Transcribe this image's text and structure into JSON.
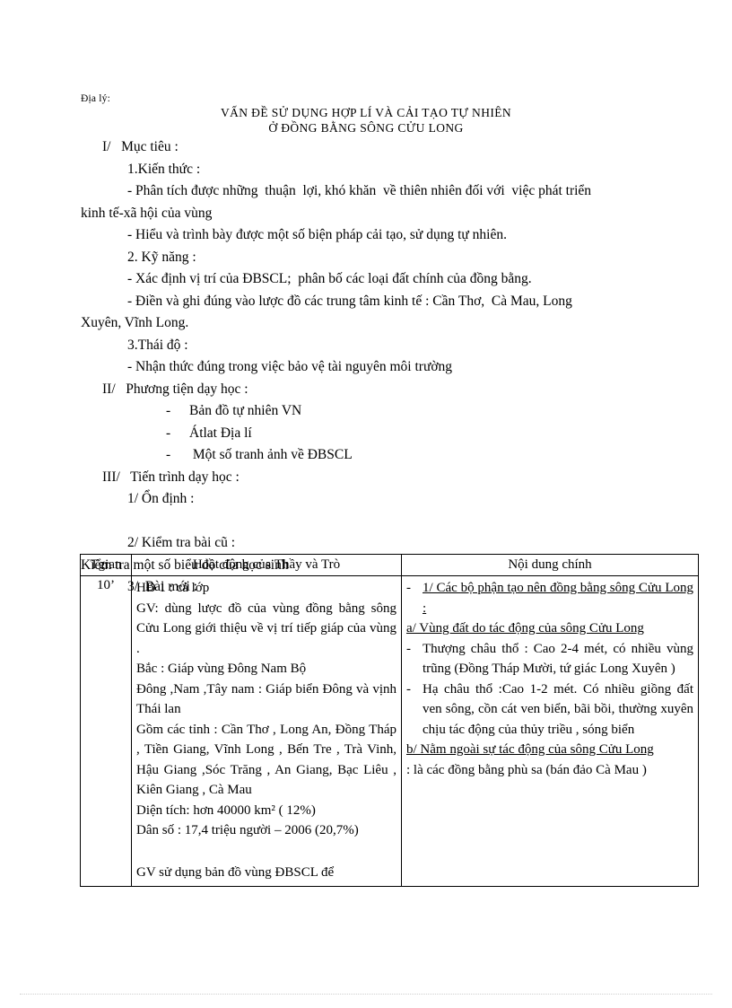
{
  "document": {
    "subject_label": "Địa lý:",
    "title_line_1": "VẤN ĐỀ SỬ DỤNG HỢP LÍ VÀ CẢI TẠO TỰ NHIÊN",
    "title_line_2": "Ở ĐỒNG BẰNG SÔNG CỬU LONG"
  },
  "sections": {
    "s1_heading": "I/   Mục tiêu :",
    "s1_1_heading": "1.Kiến thức :",
    "s1_1_item_1": "- Phân tích được những  thuận  lợi, khó khăn  về thiên nhiên đối với  việc phát triển",
    "s1_1_item_1_cont": "kinh tế-xã hội của vùng",
    "s1_1_item_2": "- Hiểu và trình bày được một số biện pháp cải tạo, sử dụng tự nhiên.",
    "s1_2_heading": "2. Kỹ năng :",
    "s1_2_item_1": "- Xác định vị trí của ĐBSCL;  phân bố các loại đất chính của đồng bằng.",
    "s1_2_item_2": "- Điền và ghi đúng vào lược đồ các trung tâm kinh tế : Cần Thơ,  Cà Mau, Long",
    "s1_2_item_2_cont": "Xuyên, Vĩnh Long.",
    "s1_3_heading": "3.Thái độ :",
    "s1_3_item_1": "- Nhận thức đúng trong việc bảo vệ tài nguyên môi trường",
    "s2_heading": "II/   Phương tiện dạy học :",
    "s2_items": [
      "Bản đồ tự nhiên VN",
      "Átlat Địa lí",
      " Một số tranh ảnh về ĐBSCL"
    ],
    "s3_heading": "III/   Tiến trình dạy học :",
    "s3_1": "1/ Ổn định :",
    "s3_2": "2/ Kiểm tra bài cũ :",
    "s3_2_detail": "Kiểm tra một số biểu đồ của học sinh",
    "s3_3": "3/  Bài mới :"
  },
  "table": {
    "headers": {
      "time": "Tgian",
      "activity": "Hoạt động của Thầy và Trò",
      "content": "Nội dung chính"
    },
    "row": {
      "time": "10’",
      "activity_lines": [
        "HĐ 1 : cả lớp",
        " GV:    dùng  lược  đồ  của  vùng  đồng bằng sông Cửu Long  giới thiệu về vị trí tiếp giáp của vùng .",
        "Bắc            : Giáp vùng Đông Nam Bộ",
        "Đông ,Nam ,Tây nam      : Giáp biển Đông và vịnh Thái lan",
        "Gồm các tỉnh : Cần Thơ , Long An, Đồng Tháp , Tiền Giang, Vĩnh Long , Bến Tre , Trà Vinh, Hậu Giang ,Sóc Trăng , An Giang, Bạc Liêu , Kiên Giang , Cà Mau",
        "Diện tích: hơn 40000 km² ( 12%)",
        "Dân số :  17,4  triệu người  –  2006 (20,7%)",
        "",
        "GV sử dụng bản đồ vùng ĐBSCL để"
      ],
      "content_bullets": [
        {
          "mark": "-",
          "heading": "1/ Các bộ phận tạo nên đồng bằng sông Cửu Long :",
          "subheading": "a/ Vùng đất do tác động của sông Cửu Long"
        },
        {
          "mark": "-",
          "text": "Thượng châu thổ : Cao 2-4 mét, có nhiều vùng trũng (Đồng Tháp Mười, tứ giác Long Xuyên )"
        },
        {
          "mark": "-",
          "text": "Hạ châu thổ :Cao 1-2 mét. Có nhiều giồng đất ven sông, cồn cát ven biển, bãi bồi, thường xuyên chịu tác động của thủy triều , sóng biển"
        }
      ],
      "content_tail_heading": "b/ Nằm ngoài sự tác động của sông Cửu Long",
      "content_tail_text": ": là các đồng bằng phù sa (bán đảo Cà Mau )"
    }
  }
}
